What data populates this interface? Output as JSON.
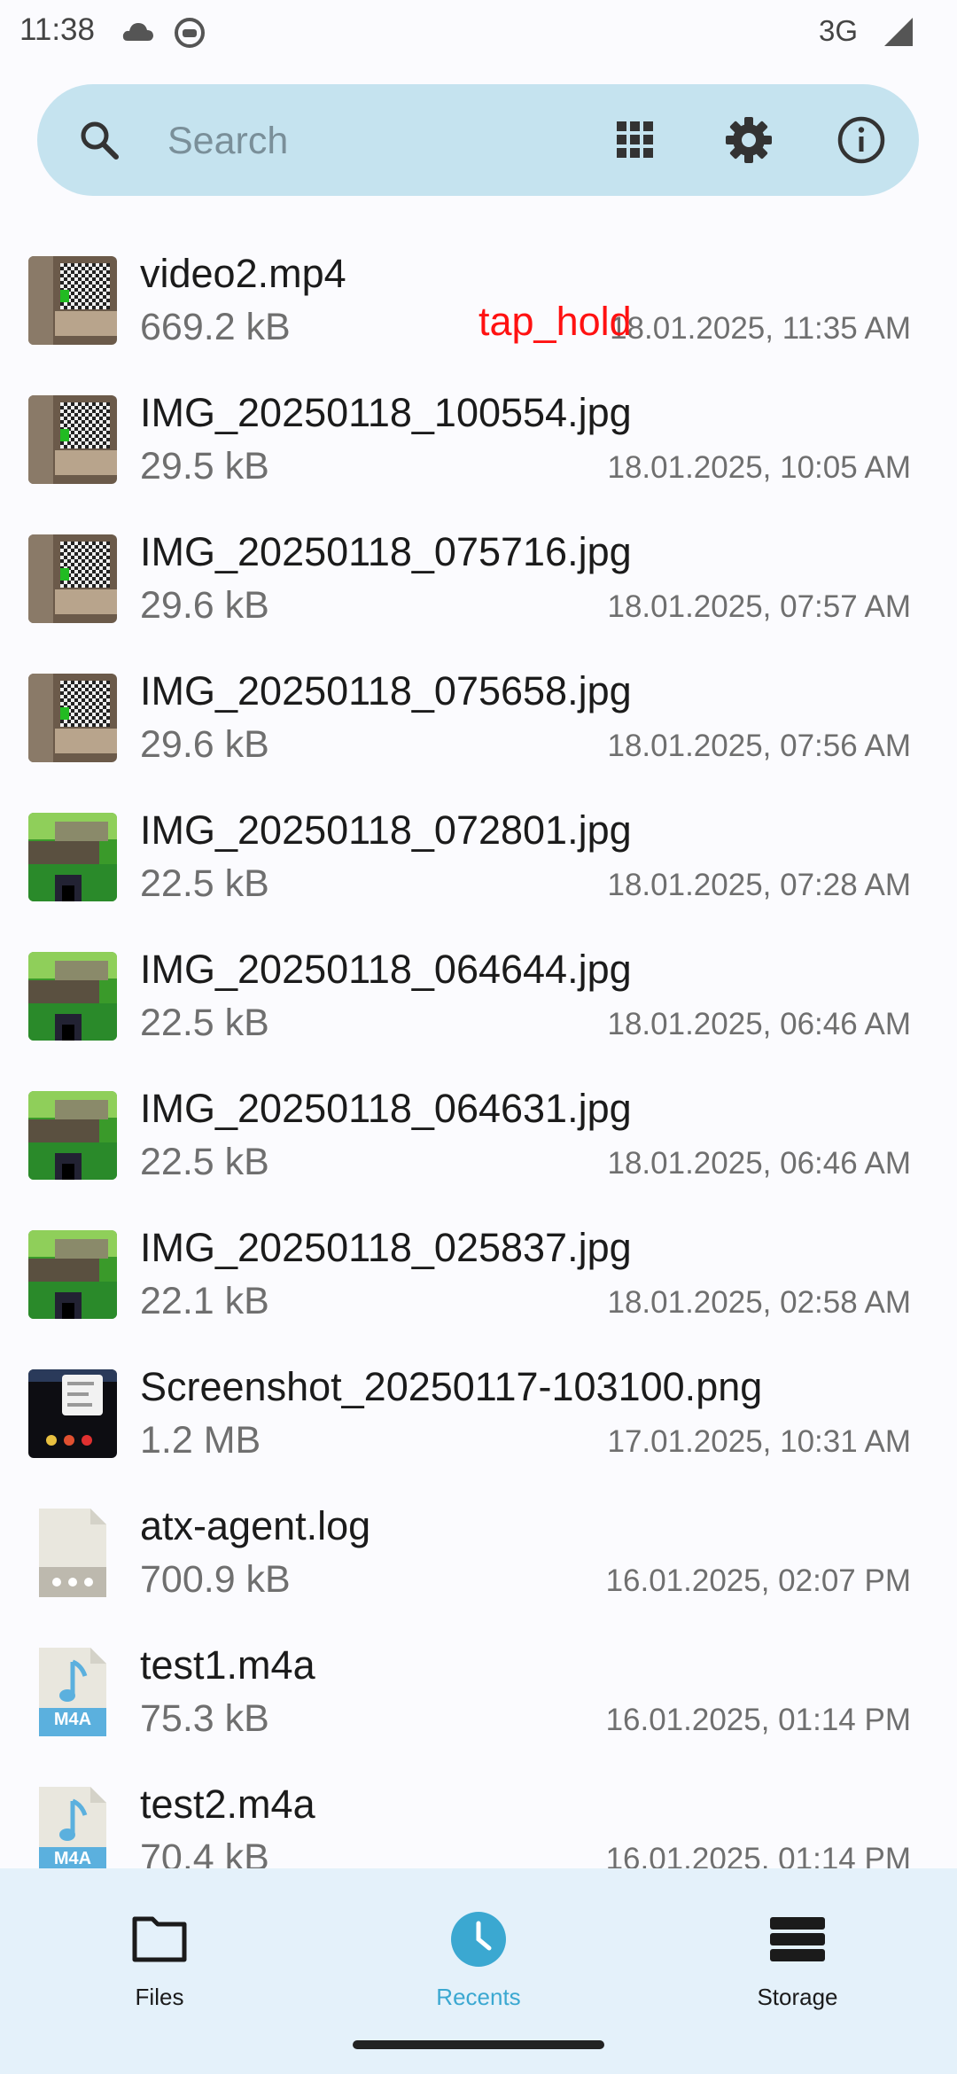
{
  "status_bar": {
    "time": "11:38",
    "network": "3G"
  },
  "search": {
    "placeholder": "Search"
  },
  "overlay": {
    "gesture_label": "tap_hold"
  },
  "files": [
    {
      "name": "video2.mp4",
      "size": "669.2 kB",
      "date": "18.01.2025, 11:35 AM",
      "thumb": "checker-room"
    },
    {
      "name": "IMG_20250118_100554.jpg",
      "size": "29.5 kB",
      "date": "18.01.2025, 10:05 AM",
      "thumb": "checker-room"
    },
    {
      "name": "IMG_20250118_075716.jpg",
      "size": "29.6 kB",
      "date": "18.01.2025, 07:57 AM",
      "thumb": "checker-room"
    },
    {
      "name": "IMG_20250118_075658.jpg",
      "size": "29.6 kB",
      "date": "18.01.2025, 07:56 AM",
      "thumb": "checker-room"
    },
    {
      "name": "IMG_20250118_072801.jpg",
      "size": "22.5 kB",
      "date": "18.01.2025, 07:28 AM",
      "thumb": "green-blocks"
    },
    {
      "name": "IMG_20250118_064644.jpg",
      "size": "22.5 kB",
      "date": "18.01.2025, 06:46 AM",
      "thumb": "green-blocks"
    },
    {
      "name": "IMG_20250118_064631.jpg",
      "size": "22.5 kB",
      "date": "18.01.2025, 06:46 AM",
      "thumb": "green-blocks"
    },
    {
      "name": "IMG_20250118_025837.jpg",
      "size": "22.1 kB",
      "date": "18.01.2025, 02:58 AM",
      "thumb": "green-blocks"
    },
    {
      "name": "Screenshot_20250117-103100.png",
      "size": "1.2 MB",
      "date": "17.01.2025, 10:31 AM",
      "thumb": "phone-screenshot"
    },
    {
      "name": "atx-agent.log",
      "size": "700.9 kB",
      "date": "16.01.2025, 02:07 PM",
      "thumb": "generic-file-icon"
    },
    {
      "name": "test1.m4a",
      "size": "75.3 kB",
      "date": "16.01.2025, 01:14 PM",
      "thumb": "audio-file-icon",
      "badge": "M4A"
    },
    {
      "name": "test2.m4a",
      "size": "70.4 kB",
      "date": "16.01.2025, 01:14 PM",
      "thumb": "audio-file-icon",
      "badge": "M4A"
    }
  ],
  "bottom_nav": {
    "items": [
      {
        "label": "Files",
        "icon": "folder-icon",
        "active": false
      },
      {
        "label": "Recents",
        "icon": "clock-icon",
        "active": true
      },
      {
        "label": "Storage",
        "icon": "storage-icon",
        "active": false
      }
    ]
  },
  "colors": {
    "accent": "#3BA8D1",
    "search_bg": "#C5E3EF",
    "nav_bg": "#E4F1FA",
    "gesture_label": "#FF1111"
  }
}
